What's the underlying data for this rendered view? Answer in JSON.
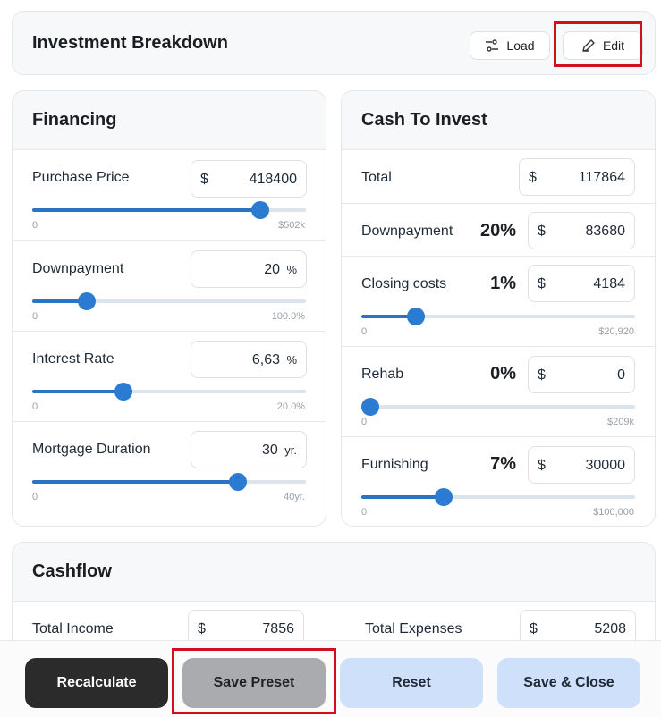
{
  "header": {
    "title": "Investment Breakdown",
    "load_label": "Load",
    "edit_label": "Edit",
    "load_icon": "sliders-icon",
    "edit_icon": "pencil-icon"
  },
  "financing": {
    "title": "Financing",
    "purchase": {
      "label": "Purchase Price",
      "currency": "$",
      "value": "418400",
      "min": "0",
      "max": "$502k",
      "level": 0.833
    },
    "downpayment": {
      "label": "Downpayment",
      "value": "20",
      "unit": "%",
      "min": "0",
      "max": "100.0%",
      "level": 0.2
    },
    "interest": {
      "label": "Interest Rate",
      "value": "6,63",
      "unit": "%",
      "min": "0",
      "max": "20.0%",
      "level": 0.332
    },
    "duration": {
      "label": "Mortgage Duration",
      "value": "30",
      "unit": "yr.",
      "min": "0",
      "max": "40yr.",
      "level": 0.75
    }
  },
  "cash": {
    "title": "Cash To Invest",
    "total": {
      "label": "Total",
      "currency": "$",
      "value": "117864"
    },
    "downpayment": {
      "label": "Downpayment",
      "pct": "20%",
      "currency": "$",
      "value": "83680"
    },
    "closing": {
      "label": "Closing costs",
      "pct": "1%",
      "currency": "$",
      "value": "4184",
      "min": "0",
      "max": "$20,920",
      "level": 0.2
    },
    "rehab": {
      "label": "Rehab",
      "pct": "0%",
      "currency": "$",
      "value": "0",
      "min": "0",
      "max": "$209k",
      "level": 0.0
    },
    "furnishing": {
      "label": "Furnishing",
      "pct": "7%",
      "currency": "$",
      "value": "30000",
      "min": "0",
      "max": "$100,000",
      "level": 0.3
    }
  },
  "cashflow": {
    "title": "Cashflow",
    "income": {
      "label": "Total Income",
      "currency": "$",
      "value": "7856"
    },
    "expenses": {
      "label": "Total Expenses",
      "currency": "$",
      "value": "5208"
    }
  },
  "footer": {
    "recalculate": "Recalculate",
    "save_preset": "Save Preset",
    "reset": "Reset",
    "save_close": "Save & Close"
  },
  "colors": {
    "accent": "#2a7bd1",
    "highlight": "#d0101a",
    "dark_button": "#2b2b2b",
    "muted_button": "#a9abaf",
    "light_button": "#cfe0fb"
  }
}
